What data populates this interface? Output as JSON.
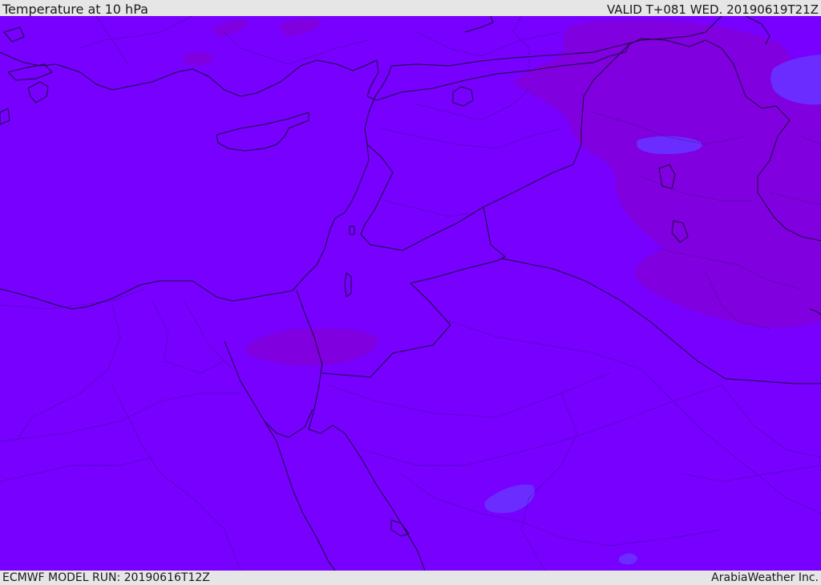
{
  "header": {
    "title": "Temperature at 10 hPa",
    "valid": "VALID T+081 WED. 20190619T21Z"
  },
  "footer": {
    "model_run": "ECMWF MODEL RUN: 20190616T12Z",
    "credit": "ArabiaWeather Inc."
  },
  "map": {
    "colors": {
      "base": "#7700ff",
      "warm": "#8000e0",
      "cool": "#6a2cff",
      "ice": "#7a20ff"
    }
  }
}
